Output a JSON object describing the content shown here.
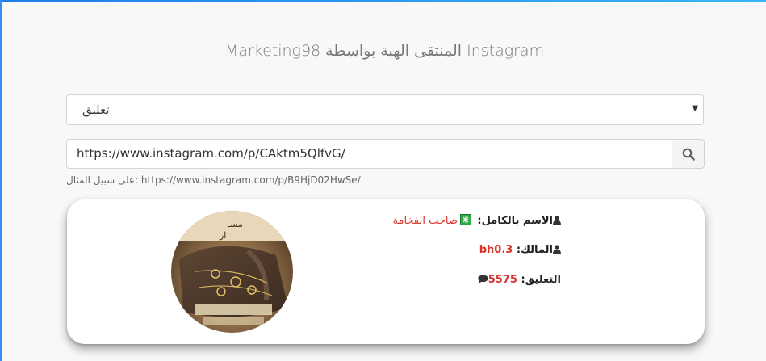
{
  "header": {
    "title": "Marketing98 المنتقى الهبة بواسطة Instagram"
  },
  "select": {
    "value": "تعليق"
  },
  "search": {
    "url_value": "https://www.instagram.com/p/CAktm5QlfvG/",
    "example": "على سبيل المثال: https://www.instagram.com/p/B9HjD02HwSe/"
  },
  "result": {
    "fullname_label": "الاسم بالكامل:",
    "fullname_value": "صاحب الفخامة",
    "owner_label": "المالك:",
    "owner_value": "bh0.3",
    "comment_label": "التعليق:",
    "comment_value": "5575"
  },
  "colors": {
    "accent": "#d9342b",
    "top_bar": "#2f94f3"
  }
}
